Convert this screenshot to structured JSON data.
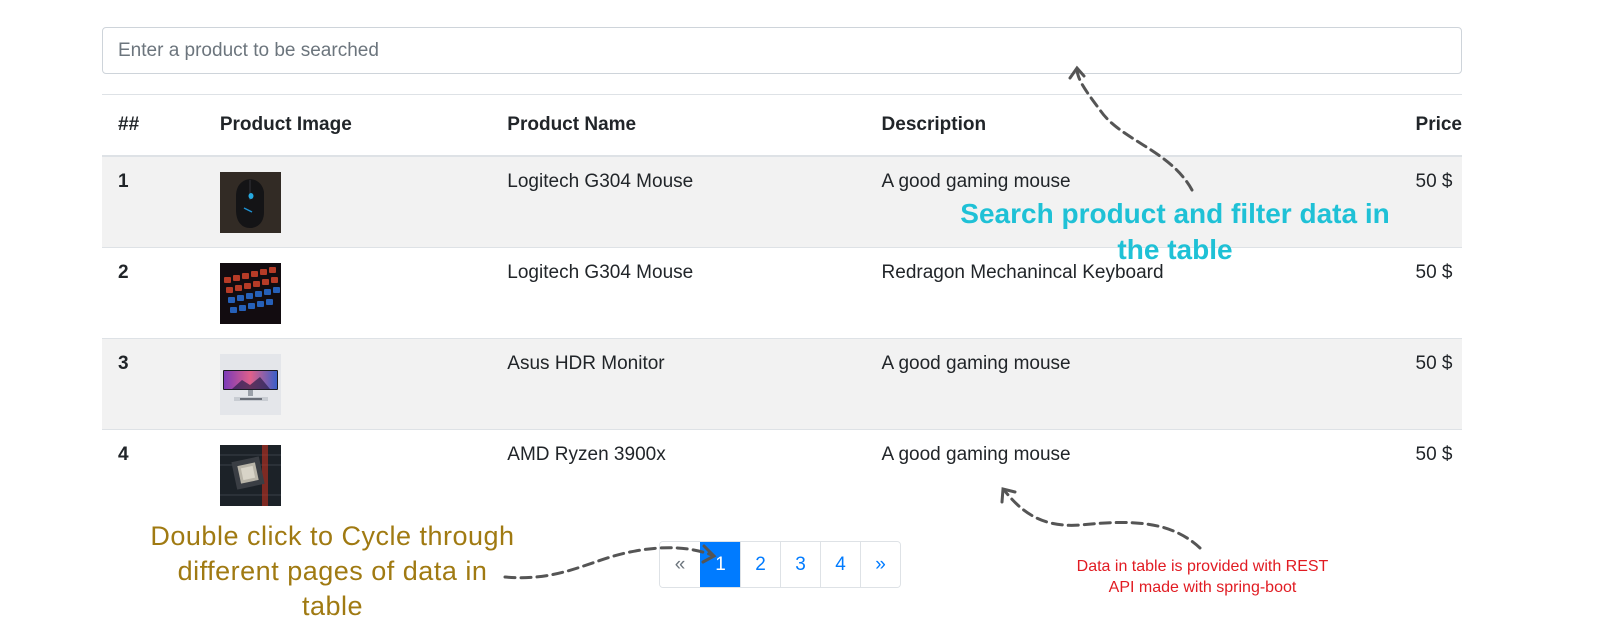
{
  "search": {
    "placeholder": "Enter a product to be searched",
    "value": ""
  },
  "table": {
    "headers": [
      "##",
      "Product Image",
      "Product Name",
      "Description",
      "Price"
    ],
    "rows": [
      {
        "num": "1",
        "image": "mouse-image",
        "name": "Logitech G304 Mouse",
        "description": "A good gaming mouse",
        "price": "50 $"
      },
      {
        "num": "2",
        "image": "keyboard-image",
        "name": "Logitech G304 Mouse",
        "description": "Redragon Mechanincal Keyboard",
        "price": "50 $"
      },
      {
        "num": "3",
        "image": "monitor-image",
        "name": "Asus HDR Monitor",
        "description": "A good gaming mouse",
        "price": "50 $"
      },
      {
        "num": "4",
        "image": "cpu-image",
        "name": "AMD Ryzen 3900x",
        "description": "A good gaming mouse",
        "price": "50 $"
      }
    ]
  },
  "pagination": {
    "prev": "«",
    "pages": [
      "1",
      "2",
      "3",
      "4"
    ],
    "active": "1",
    "next": "»"
  },
  "annotations": {
    "search": "Search product and filter data in the table",
    "cycle": "Double click to Cycle through different pages of data in table",
    "rest": "Data in table is provided with REST API made with spring-boot"
  },
  "colors": {
    "accent": "#007bff",
    "search_annotation": "#1fc1d6",
    "cycle_annotation": "#a07a12",
    "rest_annotation": "#e11b22",
    "stripe": "#f2f2f2"
  }
}
